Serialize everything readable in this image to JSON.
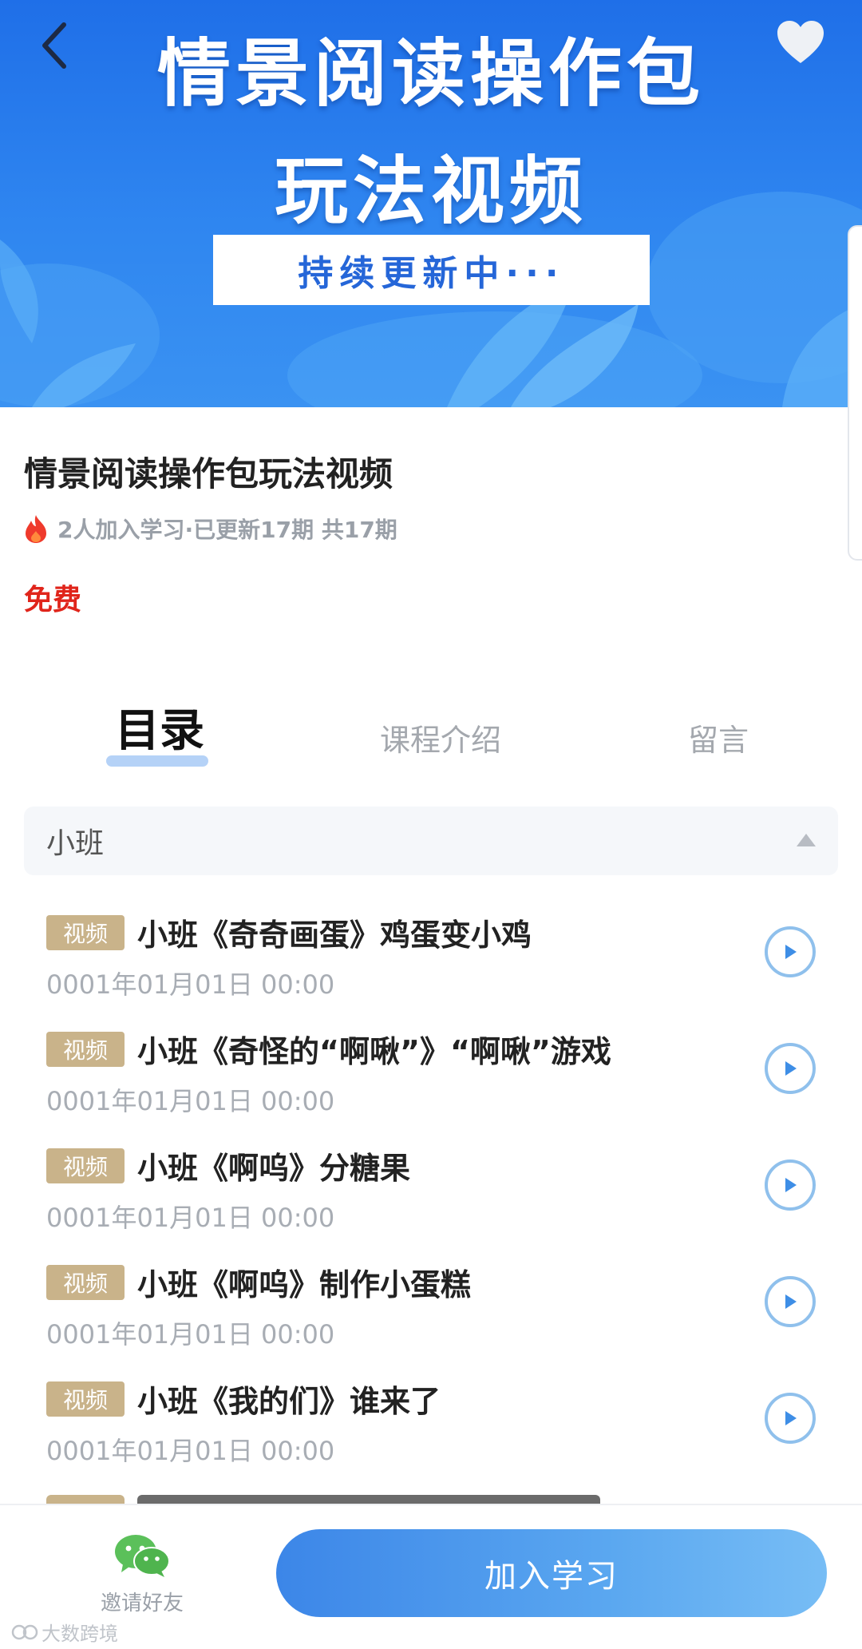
{
  "banner": {
    "line1": "情景阅读操作包",
    "line2": "玩法视频",
    "box_text": "持续更新中···"
  },
  "course": {
    "title": "情景阅读操作包玩法视频",
    "stats": "2人加入学习·已更新17期 共17期",
    "price": "免费"
  },
  "tabs": [
    {
      "label": "目录",
      "active": true
    },
    {
      "label": "课程介绍",
      "active": false
    },
    {
      "label": "留言",
      "active": false
    }
  ],
  "section": {
    "title": "小班"
  },
  "lessons": [
    {
      "tag": "视频",
      "title": "小班《奇奇画蛋》鸡蛋变小鸡",
      "date": "0001年01月01日 00:00"
    },
    {
      "tag": "视频",
      "title": "小班《奇怪的“啊啾”》“啊啾”游戏",
      "date": "0001年01月01日 00:00"
    },
    {
      "tag": "视频",
      "title": "小班《啊呜》分糖果",
      "date": "0001年01月01日 00:00"
    },
    {
      "tag": "视频",
      "title": "小班《啊呜》制作小蛋糕",
      "date": "0001年01月01日 00:00"
    },
    {
      "tag": "视频",
      "title": "小班《我的们》谁来了",
      "date": "0001年01月01日 00:00"
    }
  ],
  "bottom": {
    "invite_label": "邀请好友",
    "join_label": "加入学习"
  },
  "watermark": "大数跨境",
  "colors": {
    "banner_blue": "#2f86f0",
    "price_red": "#e0251b",
    "tag_tan": "#c9b38a",
    "play_blue": "#8fc0ec",
    "join_gradient_start": "#3c86e8",
    "join_gradient_end": "#77bdf5"
  },
  "icons": {
    "back": "chevron-left-icon",
    "favorite": "heart-icon",
    "hot": "fire-icon",
    "collapse": "triangle-up-icon",
    "play": "play-icon",
    "invite": "wechat-icon"
  }
}
